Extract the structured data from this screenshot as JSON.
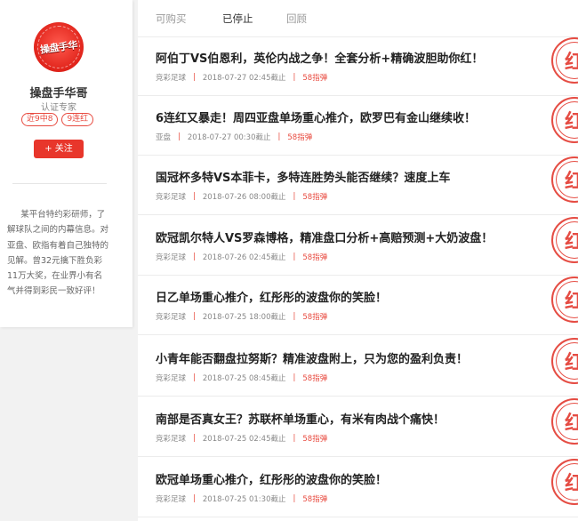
{
  "profile": {
    "avatar_logo_text": "操盘手华",
    "name": "操盘手华哥",
    "role": "认证专家",
    "badges": [
      "近9中8",
      "9连红"
    ],
    "follow_label": "+ 关注",
    "bio": "某平台特约彩研师，了解球队之间的内幕信息。对亚盘、欧指有着自己独特的见解。曾32元擒下胜负彩11万大奖，在业界小有名气并得到彩民一致好评！"
  },
  "tabs": [
    {
      "label": "可购买",
      "active": false
    },
    {
      "label": "已停止",
      "active": true
    },
    {
      "label": "回顾",
      "active": false
    }
  ],
  "articles": [
    {
      "title": "阿伯丁VS伯恩利，英伦内战之争！全套分析+精确波胆助你红！",
      "category": "竞彩足球",
      "time": "2018-07-27 02:45截止",
      "price": "58指弹",
      "stamp": "红"
    },
    {
      "title": "6连红又暴走！周四亚盘单场重心推介，欧罗巴有金山继续收！",
      "category": "亚盘",
      "time": "2018-07-27 00:30截止",
      "price": "58指弹",
      "stamp": "红"
    },
    {
      "title": "国冠杯多特VS本菲卡，多特连胜势头能否继续？速度上车",
      "category": "竞彩足球",
      "time": "2018-07-26 08:00截止",
      "price": "58指弹",
      "stamp": "红"
    },
    {
      "title": "欧冠凯尔特人VS罗森博格，精准盘口分析+高赔预测+大奶波盘！",
      "category": "竞彩足球",
      "time": "2018-07-26 02:45截止",
      "price": "58指弹",
      "stamp": "红"
    },
    {
      "title": "日乙单场重心推介，红彤彤的波盘你的笑脸！",
      "category": "竞彩足球",
      "time": "2018-07-25 18:00截止",
      "price": "58指弹",
      "stamp": "红"
    },
    {
      "title": "小青年能否翻盘拉努斯？精准波盘附上，只为您的盈利负责！",
      "category": "竞彩足球",
      "time": "2018-07-25 08:45截止",
      "price": "58指弹",
      "stamp": "红"
    },
    {
      "title": "南部是否真女王？苏联杯单场重心，有米有肉战个痛快！",
      "category": "竞彩足球",
      "time": "2018-07-25 02:45截止",
      "price": "58指弹",
      "stamp": "红"
    },
    {
      "title": "欧冠单场重心推介，红彤彤的波盘你的笑脸！",
      "category": "竞彩足球",
      "time": "2018-07-25 01:30截止",
      "price": "58指弹",
      "stamp": "红"
    }
  ],
  "colors": {
    "accent": "#e8362b",
    "stamp": "#e54c43"
  }
}
